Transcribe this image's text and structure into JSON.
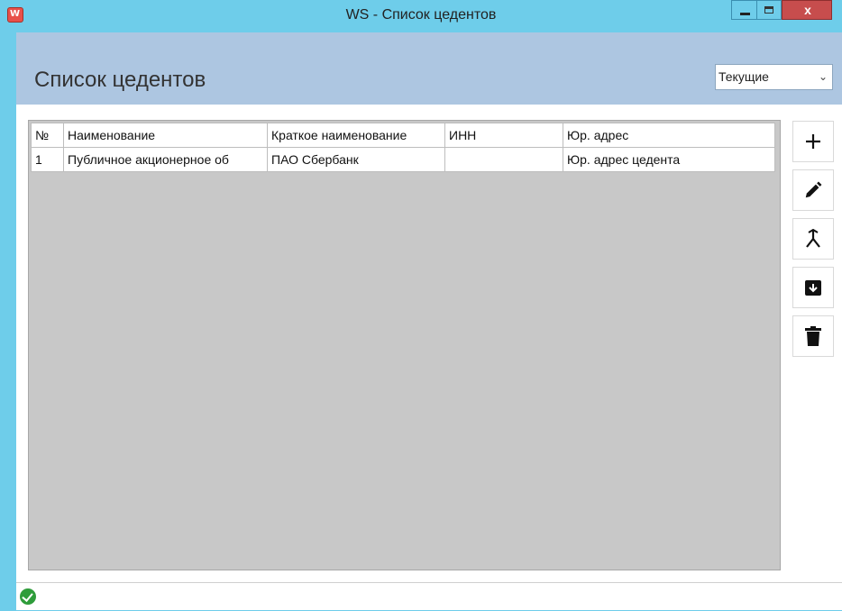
{
  "window": {
    "title": "WS - Список цедентов",
    "close_glyph": "x"
  },
  "header": {
    "title": "Список цедентов",
    "filter_value": "Текущие",
    "filter_chevron": "⌄"
  },
  "table": {
    "columns": [
      "№",
      "Наименование",
      "Краткое наименование",
      "ИНН",
      "Юр. адрес"
    ],
    "rows": [
      [
        "1",
        "Публичное акционерное об",
        "ПАО Сбербанк",
        "",
        "Юр. адрес цедента"
      ]
    ]
  },
  "toolbar": {
    "icons": [
      "plus-icon",
      "pencil-icon",
      "merge-icon",
      "archive-icon",
      "trash-icon"
    ]
  },
  "status": {
    "icon": "check-circle-icon",
    "color": "#2e9c3a"
  }
}
